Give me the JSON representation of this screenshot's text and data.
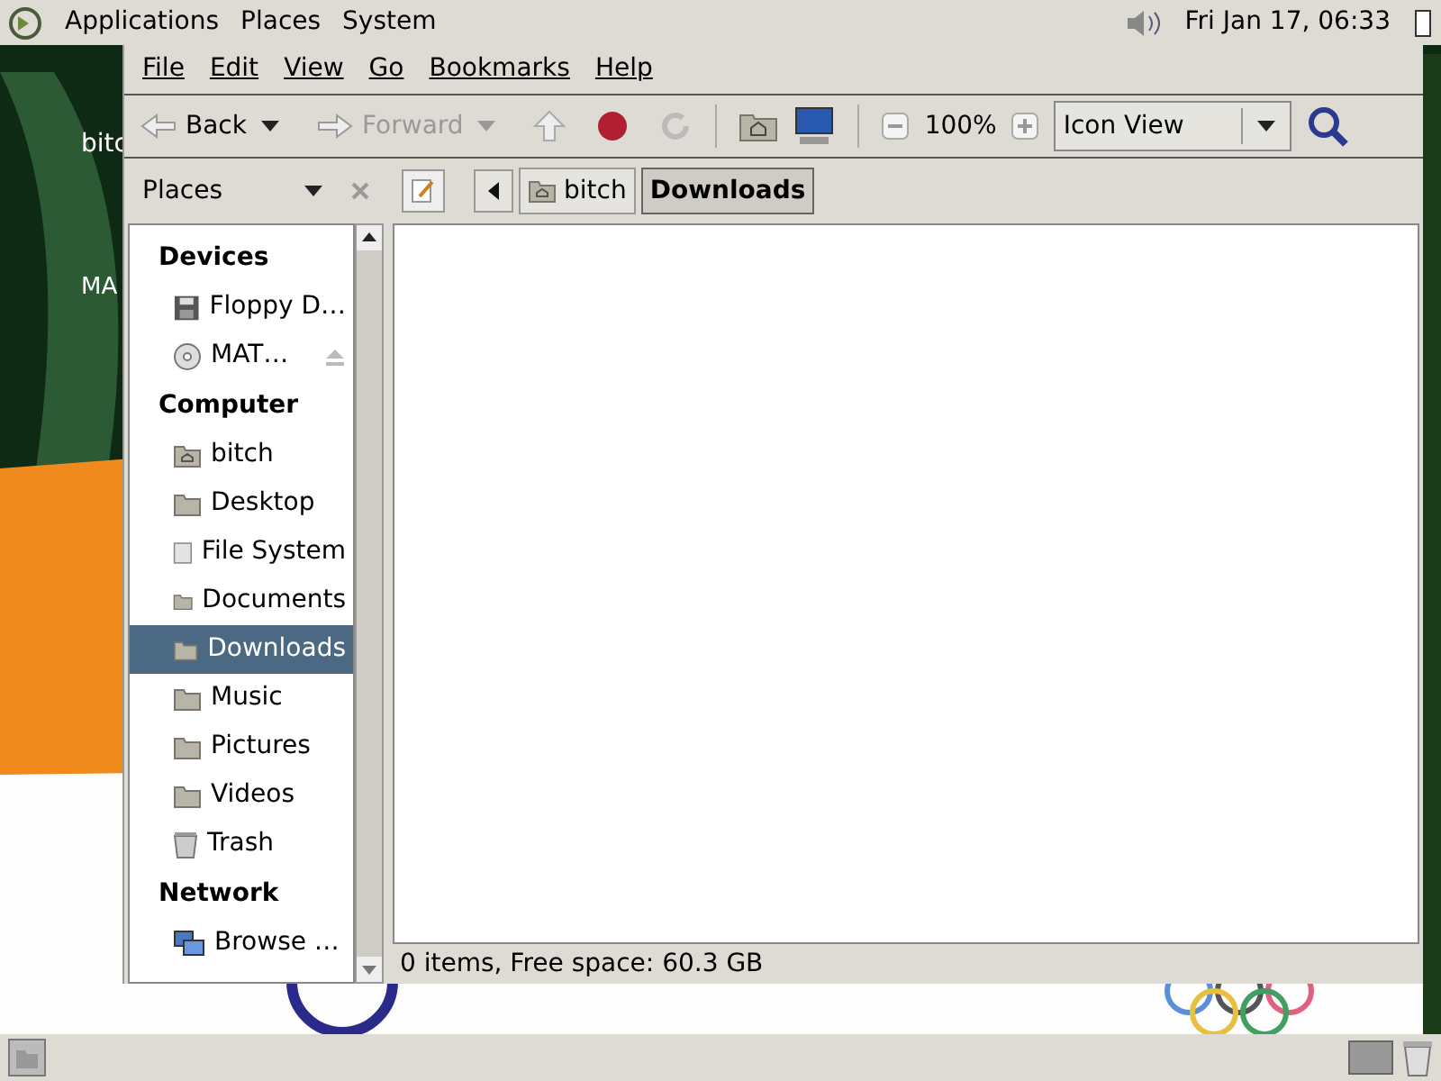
{
  "top_panel": {
    "menus": [
      "Applications",
      "Places",
      "System"
    ],
    "clock": "Fri Jan 17, 06:33"
  },
  "desktop_icons": [
    "bitc",
    "MA"
  ],
  "window": {
    "menu": [
      "File",
      "Edit",
      "View",
      "Go",
      "Bookmarks",
      "Help"
    ],
    "toolbar": {
      "back": "Back",
      "forward": "Forward",
      "forward_disabled": true,
      "zoom": "100%",
      "view": "Icon View"
    },
    "side_pane": {
      "title": "Places",
      "sections": [
        {
          "heading": "Devices",
          "items": [
            {
              "label": "Floppy D…",
              "kind": "floppy",
              "selected": false,
              "eject": false
            },
            {
              "label": "MAT…",
              "kind": "disc",
              "selected": false,
              "eject": true
            }
          ]
        },
        {
          "heading": "Computer",
          "items": [
            {
              "label": "bitch",
              "kind": "home",
              "selected": false,
              "eject": false
            },
            {
              "label": "Desktop",
              "kind": "folder",
              "selected": false,
              "eject": false
            },
            {
              "label": "File System",
              "kind": "drive",
              "selected": false,
              "eject": false
            },
            {
              "label": "Documents",
              "kind": "folder",
              "selected": false,
              "eject": false
            },
            {
              "label": "Downloads",
              "kind": "folder",
              "selected": true,
              "eject": false
            },
            {
              "label": "Music",
              "kind": "folder",
              "selected": false,
              "eject": false
            },
            {
              "label": "Pictures",
              "kind": "folder",
              "selected": false,
              "eject": false
            },
            {
              "label": "Videos",
              "kind": "folder",
              "selected": false,
              "eject": false
            },
            {
              "label": "Trash",
              "kind": "trash",
              "selected": false,
              "eject": false
            }
          ]
        },
        {
          "heading": "Network",
          "items": [
            {
              "label": "Browse …",
              "kind": "network",
              "selected": false,
              "eject": false
            }
          ]
        }
      ]
    },
    "path": [
      {
        "label": "bitch",
        "selected": false
      },
      {
        "label": "Downloads",
        "selected": true
      }
    ],
    "status": "0 items, Free space: 60.3 GB"
  }
}
